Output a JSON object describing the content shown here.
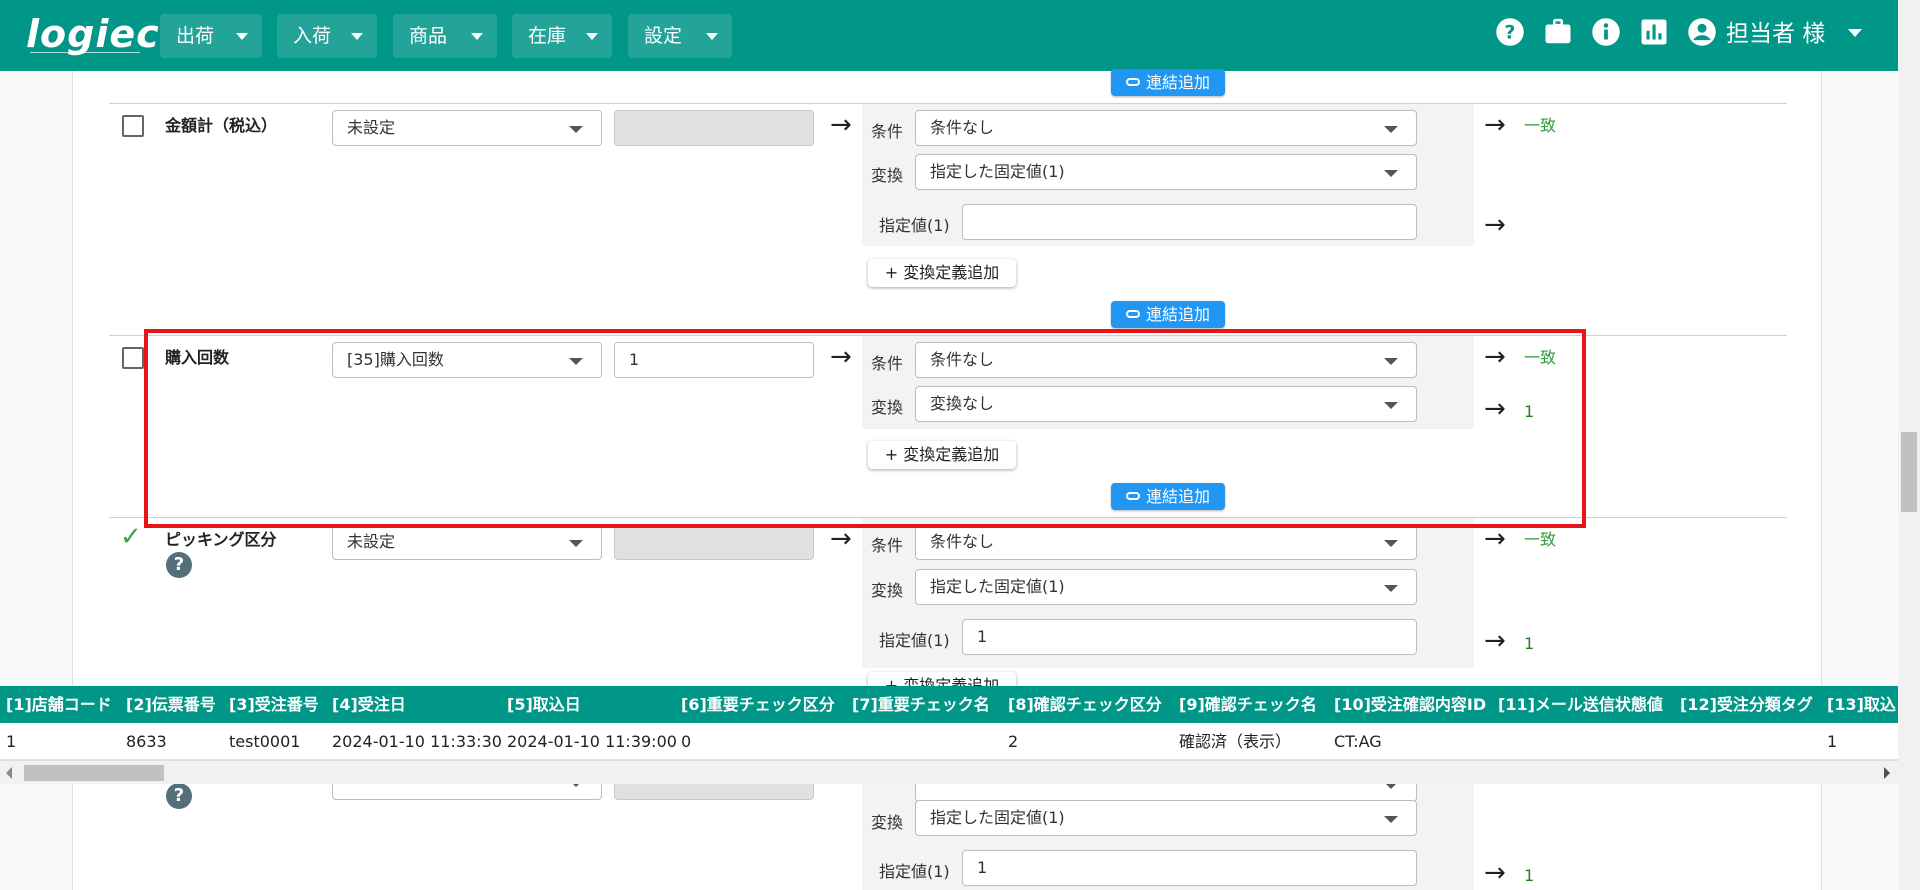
{
  "header": {
    "logo": "logiec",
    "nav": [
      {
        "label": "出荷"
      },
      {
        "label": "入荷"
      },
      {
        "label": "商品"
      },
      {
        "label": "在庫"
      },
      {
        "label": "設定"
      }
    ],
    "icons": [
      "help-circle-icon",
      "briefcase-icon",
      "info-icon",
      "bar-chart-icon",
      "account-circle-icon"
    ],
    "user": "担当者 様"
  },
  "common": {
    "link_add": "連結追加",
    "cond_label": "条件",
    "conv_label": "変換",
    "spec_label": "指定値(1)",
    "add_def": "+ 変換定義追加",
    "match": "一致",
    "help": "?"
  },
  "rows": [
    {
      "label": "金額計（税込）",
      "source": "未設定",
      "value": "",
      "condition": "条件なし",
      "conversion": "指定した固定値(1)",
      "spec_value": "",
      "result_cond": "一致",
      "result_value": ""
    },
    {
      "label": "購入回数",
      "source": "[35]購入回数",
      "value": "1",
      "condition": "条件なし",
      "conversion": "変換なし",
      "result_cond": "一致",
      "result_value": "1"
    },
    {
      "label": "ピッキング区分",
      "source": "未設定",
      "value": "",
      "condition": "条件なし",
      "conversion": "指定した固定値(1)",
      "spec_value": "1",
      "result_cond": "一致",
      "result_value": "1"
    },
    {
      "conversion": "指定した固定値(1)",
      "spec_value": "1",
      "result_value": "1"
    }
  ],
  "table": {
    "headers": [
      "[1]店舗コード",
      "[2]伝票番号",
      "[3]受注番号",
      "[4]受注日",
      "[5]取込日",
      "[6]重要チェック区分",
      "[7]重要チェック名",
      "[8]確認チェック区分",
      "[9]確認チェック名",
      "[10]受注確認内容ID",
      "[11]メール送信状態値",
      "[12]受注分類タグ",
      "[13]取込"
    ],
    "row": [
      "1",
      "8633",
      "test0001",
      "2024-01-10 11:33:30",
      "2024-01-10 11:39:00",
      "0",
      "",
      "2",
      "確認済（表示）",
      "CT:AG",
      "",
      "",
      "1"
    ]
  },
  "colors": {
    "primary": "#009688",
    "link": "#2196f3",
    "highlight": "#e8141a",
    "match": "#2e9d3a"
  }
}
